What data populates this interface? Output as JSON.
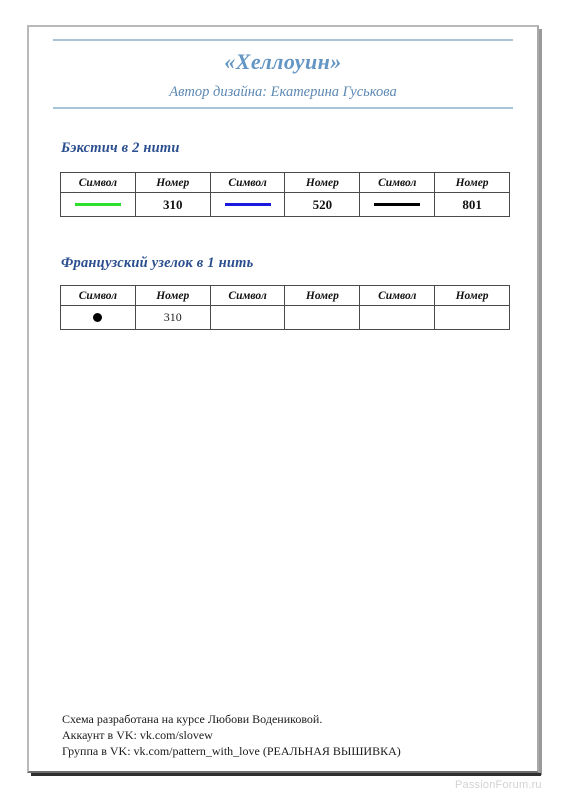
{
  "document": {
    "title": "«Хеллоуин»",
    "subtitle": "Автор дизайна: Екатерина Гуськова"
  },
  "sections": [
    {
      "heading": "Бэкстич в 2 нити",
      "columns": [
        "Символ",
        "Номер",
        "Символ",
        "Номер",
        "Символ",
        "Номер"
      ],
      "entries": [
        {
          "symbol_type": "line",
          "symbol_color": "#2ee02e",
          "number": "310"
        },
        {
          "symbol_type": "line",
          "symbol_color": "#1a1ae0",
          "number": "520"
        },
        {
          "symbol_type": "line",
          "symbol_color": "#000000",
          "number": "801"
        }
      ]
    },
    {
      "heading": "Французский узелок в 1 нить",
      "columns": [
        "Символ",
        "Номер",
        "Символ",
        "Номер",
        "Символ",
        "Номер"
      ],
      "entries": [
        {
          "symbol_type": "dot",
          "symbol_color": "#000000",
          "number": "310"
        },
        {
          "symbol_type": "none",
          "symbol_color": "",
          "number": ""
        },
        {
          "symbol_type": "none",
          "symbol_color": "",
          "number": ""
        }
      ]
    }
  ],
  "footer": {
    "line1": "Схема разработана на курсе Любови Водениковой.",
    "line2": "Аккаунт в VK: vk.com/slovew",
    "line3": "Группа в VK: vk.com/pattern_with_love (РЕАЛЬНАЯ ВЫШИВКА)"
  },
  "watermark": "PassionForum.ru",
  "colors": {
    "title_blue": "#6396c4",
    "heading_navy": "#2b4f8e",
    "rule_blue": "#a8c4d8",
    "page_border": "#b9b9b9"
  }
}
